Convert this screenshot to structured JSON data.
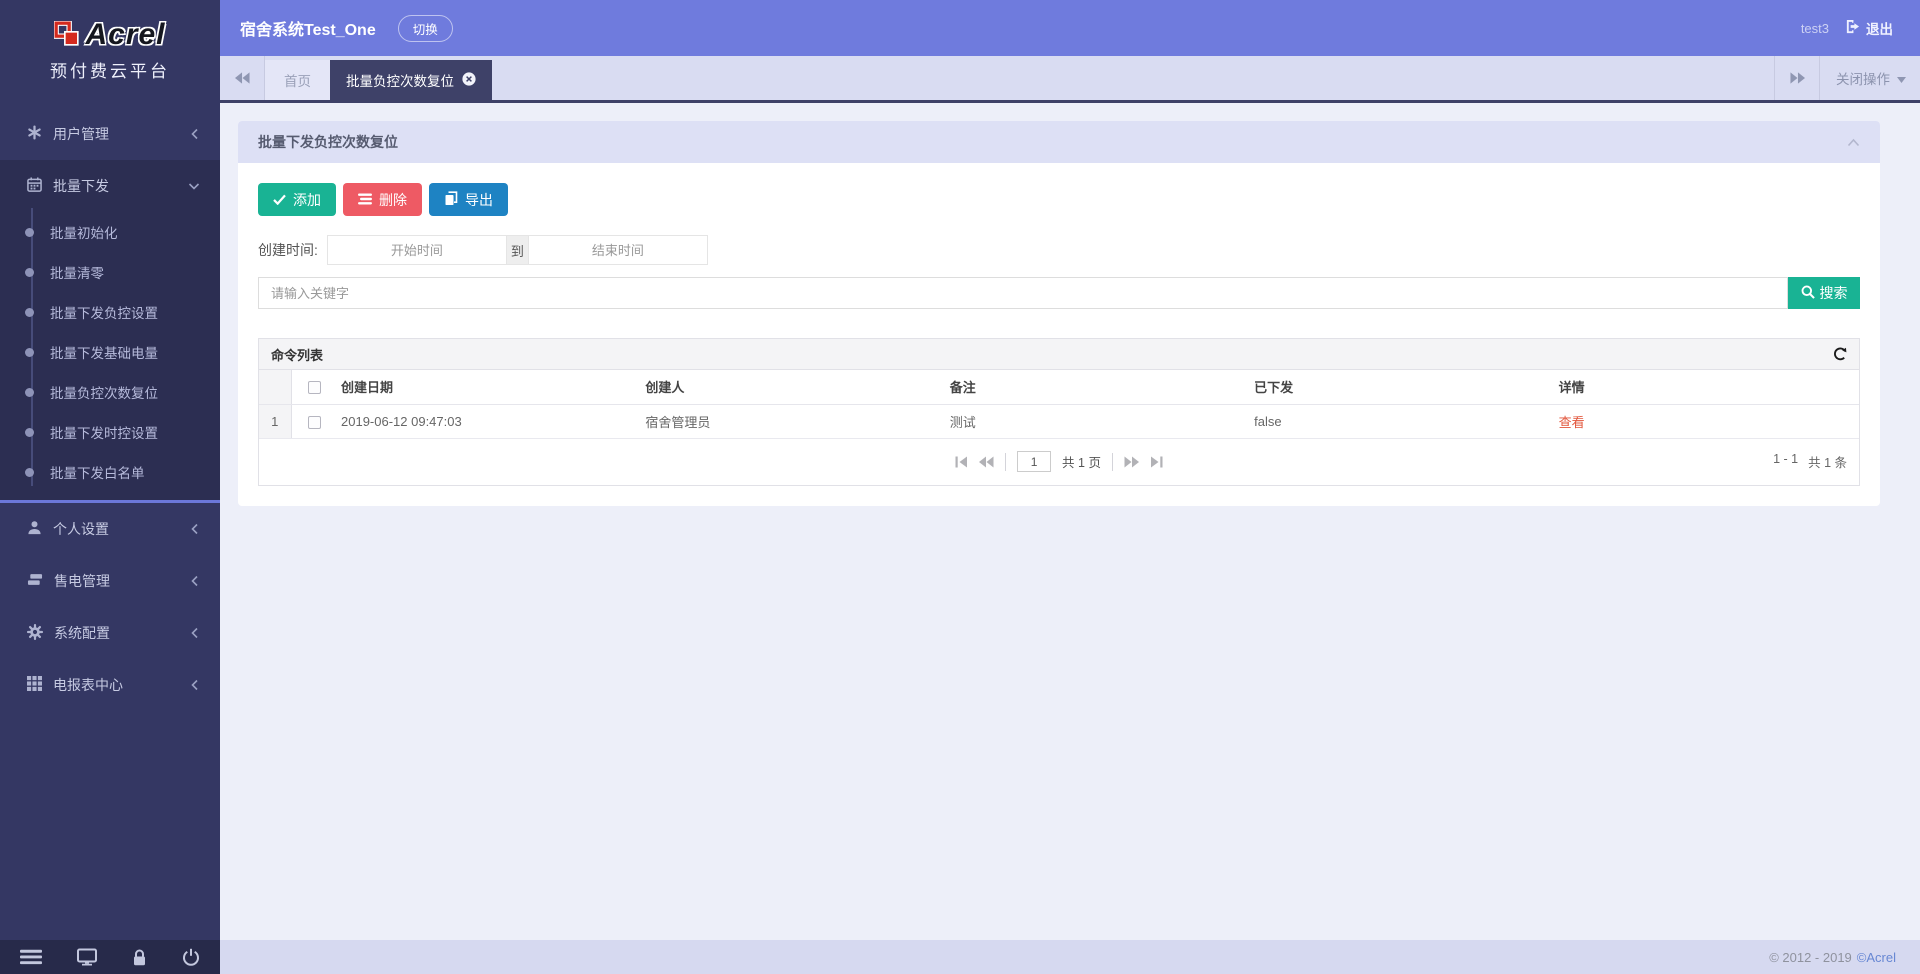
{
  "sidebar": {
    "brand": "Acrel",
    "subtitle": "预付费云平台",
    "menu": [
      {
        "label": "用户管理"
      },
      {
        "label": "批量下发",
        "children": [
          "批量初始化",
          "批量清零",
          "批量下发负控设置",
          "批量下发基础电量",
          "批量负控次数复位",
          "批量下发时控设置",
          "批量下发白名单"
        ]
      },
      {
        "label": "个人设置"
      },
      {
        "label": "售电管理"
      },
      {
        "label": "系统配置"
      },
      {
        "label": "电报表中心"
      }
    ]
  },
  "topbar": {
    "system_name": "宿舍系统Test_One",
    "switch_label": "切换",
    "username": "test3",
    "logout_label": "退出"
  },
  "tabbar": {
    "home_tab": "首页",
    "active_tab": "批量负控次数复位",
    "close_menu": "关闭操作"
  },
  "panel": {
    "title": "批量下发负控次数复位",
    "toolbar": {
      "add_label": "添加",
      "delete_label": "删除",
      "export_label": "导出"
    },
    "filters": {
      "create_time_label": "创建时间:",
      "start_placeholder": "开始时间",
      "to_label": "到",
      "end_placeholder": "结束时间",
      "keyword_placeholder": "请输入关键字",
      "search_label": "搜索"
    },
    "table": {
      "title": "命令列表",
      "columns": [
        "创建日期",
        "创建人",
        "备注",
        "已下发",
        "详情"
      ],
      "rows": [
        {
          "num": "1",
          "create_date": "2019-06-12 09:47:03",
          "creator": "宿舍管理员",
          "remark": "测试",
          "sent": "false",
          "detail_label": "查看"
        }
      ],
      "pager": {
        "page": "1",
        "pages_label": "共 1 页",
        "range": "1 - 1",
        "total": "共 1 条"
      }
    }
  },
  "footer": {
    "copyright": "© 2012 - 2019",
    "brand": "©Acrel"
  },
  "colors": {
    "sidebar_bg": "#343763",
    "submenu_bg": "#2c2e52",
    "sidebar_bottom_bg": "#272a4a",
    "sidebar_divider": "#6b77d9",
    "header_bg": "#6f7bdd",
    "tabbar_bg": "#d9dcf2",
    "tab_active_bg": "#3e4168",
    "content_bg": "#edeff9",
    "panel_header_bg": "#dde0f5",
    "green_accent": "#19b394",
    "red_accent": "#ee5a64",
    "blue_accent": "#1e83c3",
    "detail_link": "#e2553b",
    "footer_bg": "#d6d9f0",
    "footer_link": "#6787d3",
    "logo_red": "#d42a1e"
  },
  "icons": {
    "logo": "red overlapping squares",
    "user_mgmt": "asterisk",
    "batch_send": "calendar",
    "personal": "user silhouette",
    "sale": "stacked cards",
    "system": "gear",
    "report": "grid",
    "bottom_bar": [
      "hamburger-menu",
      "monitor",
      "lock",
      "power"
    ],
    "toolbar": [
      "check",
      "list-bars",
      "copy-pages"
    ],
    "search": "magnifier",
    "refresh": "circular-arrow"
  }
}
